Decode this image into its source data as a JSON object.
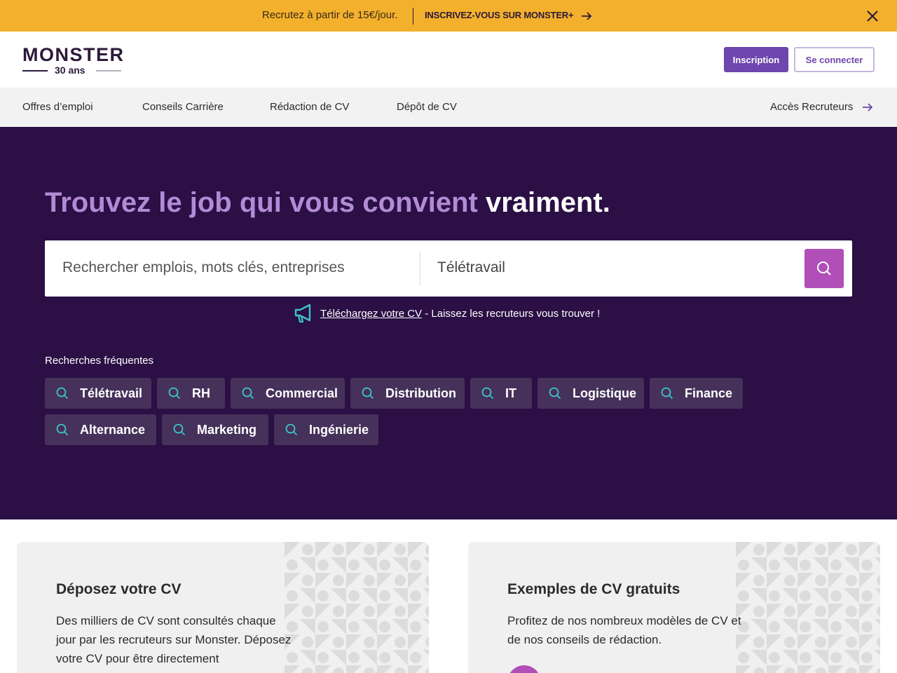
{
  "banner": {
    "text": "Recrutez à partir de 15€/jour.",
    "cta": "INSCRIVEZ-VOUS SUR MONSTER+",
    "arrow_icon": "arrow-right-icon",
    "close_icon": "close-icon"
  },
  "header": {
    "logo_word": "MONSTER",
    "logo_sub": "30 ans",
    "signup_label": "Inscription",
    "login_label": "Se connecter"
  },
  "nav": {
    "items": [
      "Offres d’emploi",
      "Conseils Carrière",
      "Rédaction de CV",
      "Dépôt de CV"
    ],
    "recruiters_label": "Accès Recruteurs"
  },
  "hero": {
    "title_part1": "Trouvez le job qui vous convient ",
    "title_emph": "vraiment.",
    "search_placeholder": "Rechercher emplois, mots clés, entreprises",
    "location_value": "Télétravail",
    "cv_link": "Téléchargez votre CV",
    "cv_suffix": " - Laissez les recruteurs vous trouver !",
    "frequent_title": "Recherches fréquentes",
    "chips": [
      "Télétravail",
      "RH",
      "Commercial",
      "Distribution",
      "IT",
      "Logistique",
      "Finance",
      "Alternance",
      "Marketing",
      "Ingénierie"
    ]
  },
  "cards": [
    {
      "title": "Déposez votre CV",
      "text": "Des milliers de CV sont consultés chaque jour par les recruteurs sur Monster. Déposez votre CV pour être directement"
    },
    {
      "title": "Exemples de CV gratuits",
      "text": "Profitez de nos nombreux modèles de CV et de nos conseils de rédaction."
    }
  ],
  "colors": {
    "banner": "#f3b02c",
    "brand_purple": "#6e46ae",
    "hero_bg": "#2b0f45",
    "search_button": "#b04fb8",
    "chip_bg": "#45315a",
    "icon_teal": "#3ec3c8"
  }
}
